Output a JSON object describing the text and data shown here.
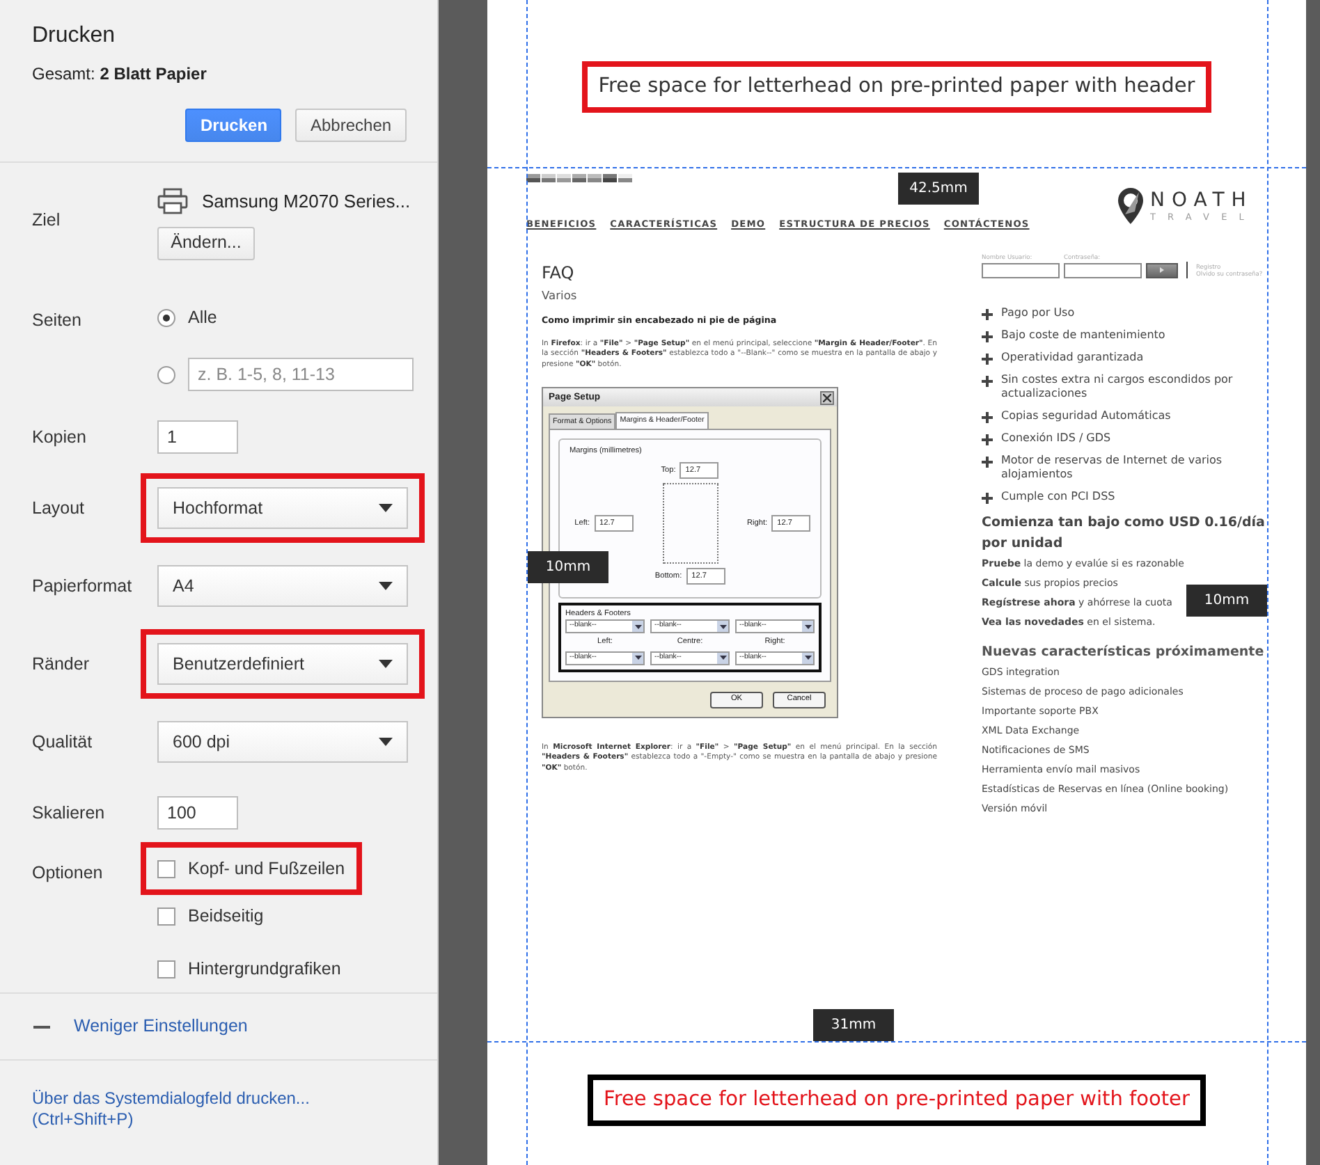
{
  "sidebar": {
    "title": "Drucken",
    "total": "Gesamt: **2 Blatt Papier**",
    "actions": [
      {
        "kind": "primary",
        "label": "Drucken"
      },
      {
        "kind": "secondary",
        "label": "Abbrechen"
      }
    ],
    "settings": [
      {
        "kind": "destination",
        "label": "Ziel",
        "printer": "Samsung M2070 Series...",
        "button": "Ändern..."
      },
      {
        "kind": "pages",
        "label": "Seiten",
        "options": [
          {
            "text": "Alle",
            "selected": true
          },
          {
            "placeholder": "z. B. 1-5, 8, 11-13",
            "selected": false
          }
        ]
      },
      {
        "kind": "input",
        "label": "Kopien",
        "value": "1"
      },
      {
        "kind": "select",
        "label": "Layout",
        "value": "Hochformat",
        "highlighted": true
      },
      {
        "kind": "select",
        "label": "Papierformat",
        "value": "A4",
        "highlighted": false
      },
      {
        "kind": "select",
        "label": "Ränder",
        "value": "Benutzerdefiniert",
        "highlighted": true
      },
      {
        "kind": "select",
        "label": "Qualität",
        "value": "600 dpi",
        "highlighted": false
      },
      {
        "kind": "input",
        "label": "Skalieren",
        "value": "100"
      },
      {
        "kind": "checkboxes",
        "label": "Optionen",
        "items": [
          {
            "text": "Kopf- und Fußzeilen",
            "checked": false,
            "highlighted": true
          },
          {
            "text": "Beidseitig",
            "checked": false,
            "highlighted": false
          },
          {
            "text": "Hintergrundgrafiken",
            "checked": false,
            "highlighted": false
          }
        ]
      }
    ],
    "less_settings": "Weniger Einstellungen",
    "system_dialog": {
      "text": "Über das Systemdialogfeld drucken...",
      "shortcut": "(Ctrl+Shift+P)"
    }
  },
  "preview": {
    "notes": [
      {
        "kind": "header",
        "text": "Free space for letterhead on pre-printed paper with header"
      },
      {
        "kind": "footer",
        "text": "Free space for letterhead on pre-printed paper with footer"
      }
    ],
    "margins": [
      {
        "kind": "top",
        "text": "42.5mm"
      },
      {
        "kind": "left",
        "text": "10mm"
      },
      {
        "kind": "right",
        "text": "10mm"
      },
      {
        "kind": "bottom",
        "text": "31mm"
      }
    ],
    "page": {
      "nav": [
        "BENEFICIOS",
        "CARACTERÍSTICAS",
        "DEMO",
        "ESTRUCTURA DE PRECIOS",
        "CONTÁCTENOS"
      ],
      "logo": {
        "name": "NOATH",
        "tagline": "TRAVEL"
      },
      "login": {
        "user_label": "Nombre Usuario:",
        "password_label": "Contraseña:",
        "links": [
          "Registro",
          "Olvido su contraseña?"
        ]
      },
      "faq": {
        "title": "FAQ",
        "subtitle": "Varios",
        "question": "Como imprimir sin encabezado ni pie de página",
        "intro": "In **Firefox**: ir a **\"File\"** > **\"Page Setup\"** en el menú principal, seleccione **\"Margin & Header/Footer\"**. En la sección **\"Headers & Footers\"** establezca todo a \"--Blank--\" como se muestra en la pantalla de abajo y presione **\"OK\"** botón.",
        "outro": "In **Microsoft Internet Explorer**: ir a **\"File\"** > **\"Page Setup\"** en el menú principal. En la sección **\"Headers & Footers\"** establezca todo a \"-Empty-\" como se muestra en la pantalla de abajo y presione **\"OK\"** botón."
      },
      "dialog": {
        "title": "Page Setup",
        "tabs": [
          {
            "label": "Format & Options",
            "selected": false
          },
          {
            "label": "Margins & Header/Footer",
            "selected": true
          }
        ],
        "margins_group": "Margins (millimetres)",
        "fields": [
          {
            "kind": "top",
            "label": "Top:",
            "value": "12.7"
          },
          {
            "kind": "left",
            "label": "Left:",
            "value": "12.7"
          },
          {
            "kind": "right",
            "label": "Right:",
            "value": "12.7"
          },
          {
            "kind": "bottom",
            "label": "Bottom:",
            "value": "12.7"
          }
        ],
        "hf_group": "Headers & Footers",
        "selects_top": [
          "--blank--",
          "--blank--",
          "--blank--"
        ],
        "hf_labels": [
          "Left:",
          "Centre:",
          "Right:"
        ],
        "selects_bottom": [
          "--blank--",
          "--blank--",
          "--blank--"
        ],
        "buttons": [
          "OK",
          "Cancel"
        ]
      },
      "features": [
        "Pago por Uso",
        "Bajo coste de mantenimiento",
        "Operatividad garantizada",
        "Sin costes extra ni cargos escondidos por actualizaciones",
        "Copias seguridad Automáticas",
        "Conexión IDS / GDS",
        "Motor de reservas de Internet de varios alojamientos",
        "Cumple con PCI DSS"
      ],
      "pricing": {
        "heading": "Comienza tan bajo como USD 0.16/día por unidad",
        "lines": [
          {
            "link": "Pruebe",
            "text": "la demo y evalúe si es razonable"
          },
          {
            "link": "Calcule",
            "text": "sus propios precios"
          },
          {
            "link": "Regístrese ahora",
            "text": "y ahórrese la cuota"
          },
          {
            "link": "Vea las novedades",
            "text": "en el sistema."
          }
        ]
      },
      "upcoming": {
        "heading": "Nuevas características próximamente",
        "items": [
          "GDS integration",
          "Sistemas de proceso de pago adicionales",
          "Importante soporte PBX",
          "XML Data Exchange",
          "Notificaciones de SMS",
          "Herramienta envío mail masivos",
          "Estadísticas de Reservas en línea (Online booking)",
          "Versión móvil"
        ]
      }
    }
  }
}
